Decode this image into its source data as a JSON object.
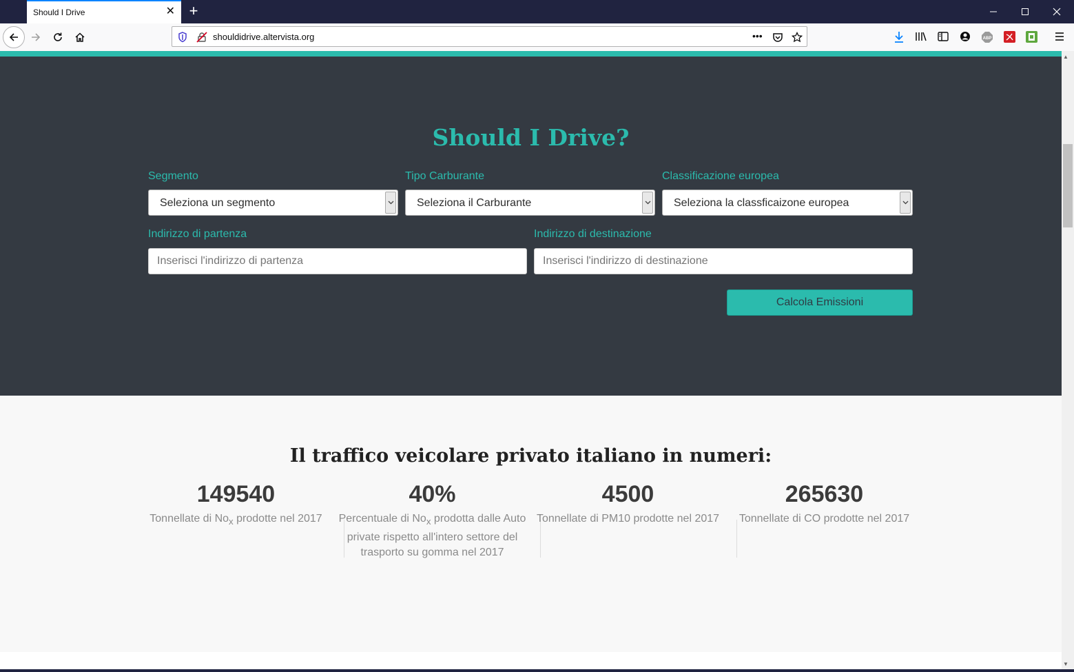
{
  "browser": {
    "tab_title": "Should I Drive",
    "url": "shouldidrive.altervista.org",
    "page_actions_label": "•••"
  },
  "hero": {
    "title": "Should I Drive?",
    "segment": {
      "label": "Segmento",
      "value": "Seleziona un segmento"
    },
    "fuel": {
      "label": "Tipo Carburante",
      "value": "Seleziona il Carburante"
    },
    "euro_class": {
      "label": "Classificazione europea",
      "value": "Seleziona la classficaizone europea"
    },
    "start": {
      "label": "Indirizzo di partenza",
      "placeholder": "Inserisci l'indirizzo di partenza"
    },
    "destination": {
      "label": "Indirizzo di destinazione",
      "placeholder": "Inserisci l'indirizzo di destinazione"
    },
    "submit_label": "Calcola Emissioni"
  },
  "stats": {
    "title": "Il traffico veicolare privato italiano in numeri:",
    "items": [
      {
        "value": "149540",
        "desc_pre": "Tonnellate di No",
        "desc_sub": "x",
        "desc_post": " prodotte nel 2017"
      },
      {
        "value": "40%",
        "desc_pre": "Percentuale di No",
        "desc_sub": "x",
        "desc_post": " prodotta dalle Auto private rispetto all'intero settore del trasporto su gomma nel 2017"
      },
      {
        "value": "4500",
        "desc_pre": "Tonnellate di PM10 prodotte nel 2017",
        "desc_sub": "",
        "desc_post": ""
      },
      {
        "value": "265630",
        "desc_pre": "Tonnellate di CO prodotte nel 2017",
        "desc_sub": "",
        "desc_post": ""
      }
    ]
  },
  "colors": {
    "accent": "#2bbbad",
    "hero_bg": "#343a42",
    "tabbar_bg": "#202340"
  },
  "icons": [
    "back-arrow-icon",
    "forward-arrow-icon",
    "reload-icon",
    "home-icon",
    "shield-icon",
    "insecure-lock-icon",
    "page-actions-icon",
    "pocket-icon",
    "star-icon",
    "download-icon",
    "library-icon",
    "sidebar-icon",
    "account-icon",
    "adblock-icon",
    "pdf-extension-icon",
    "green-extension-icon",
    "menu-icon"
  ]
}
